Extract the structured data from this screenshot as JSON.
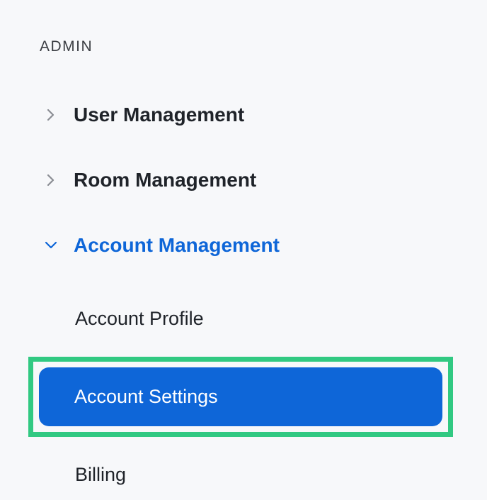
{
  "sidebar": {
    "section_header": "ADMIN",
    "items": [
      {
        "label": "User Management",
        "expanded": false
      },
      {
        "label": "Room Management",
        "expanded": false
      },
      {
        "label": "Account Management",
        "expanded": true
      }
    ],
    "sub_items": [
      {
        "label": "Account Profile",
        "active": false,
        "highlighted": false
      },
      {
        "label": "Account Settings",
        "active": true,
        "highlighted": true
      },
      {
        "label": "Billing",
        "active": false,
        "highlighted": false
      }
    ]
  }
}
